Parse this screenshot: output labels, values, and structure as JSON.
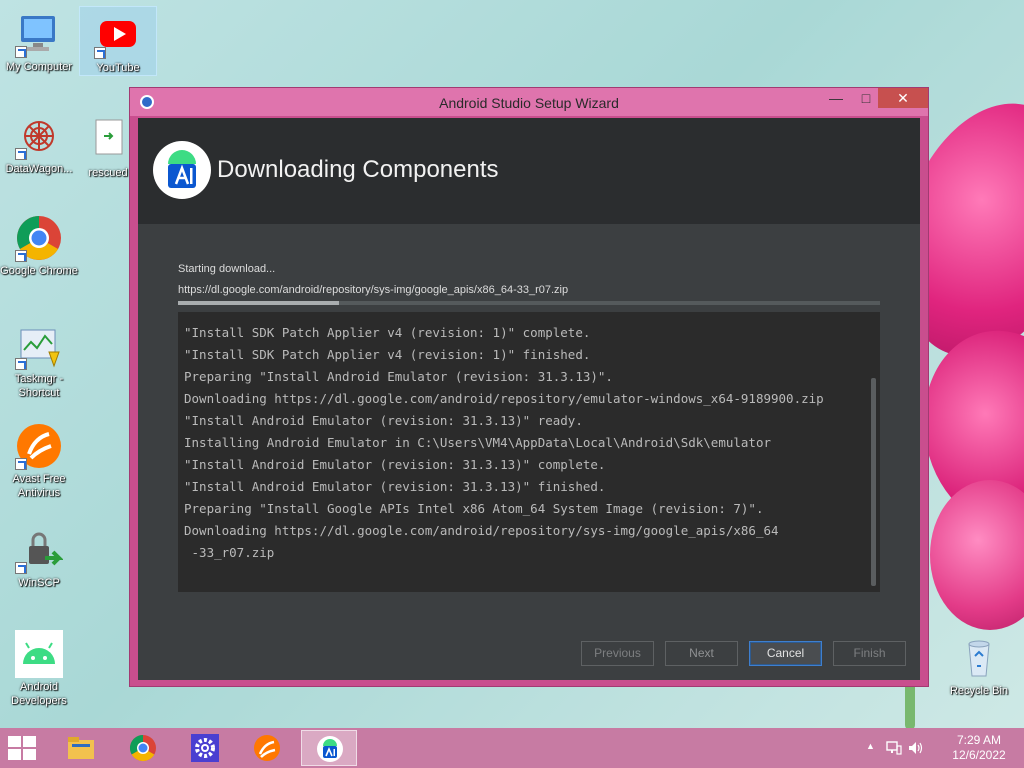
{
  "desktop": {
    "icons": [
      {
        "label": "My Computer",
        "icon": "my-computer-icon"
      },
      {
        "label": "YouTube",
        "icon": "youtube-icon"
      },
      {
        "label": "DataWagon...",
        "icon": "datawagon-icon"
      },
      {
        "label": "rescued",
        "icon": "document-icon"
      },
      {
        "label": "Google Chrome",
        "icon": "chrome-icon"
      },
      {
        "label": "Taskmgr - Shortcut",
        "icon": "taskmgr-icon"
      },
      {
        "label": "Avast Free Antivirus",
        "icon": "avast-icon"
      },
      {
        "label": "WinSCP",
        "icon": "winscp-icon"
      },
      {
        "label": "Android Developers",
        "icon": "android-icon"
      },
      {
        "label": "Recycle Bin",
        "icon": "recycle-bin-icon"
      }
    ]
  },
  "window": {
    "title": "Android Studio Setup Wizard",
    "controls": {
      "minimize": "—",
      "maximize": "□",
      "close": "✕"
    },
    "header": {
      "title": "Downloading Components"
    },
    "status": "Starting download...",
    "url": "https://dl.google.com/android/repository/sys-img/google_apis/x86_64-33_r07.zip",
    "progress": 0.23,
    "log": [
      "\"Install SDK Patch Applier v4 (revision: 1)\" complete.",
      "\"Install SDK Patch Applier v4 (revision: 1)\" finished.",
      "Preparing \"Install Android Emulator (revision: 31.3.13)\".",
      "Downloading https://dl.google.com/android/repository/emulator-windows_x64-9189900.zip",
      "\"Install Android Emulator (revision: 31.3.13)\" ready.",
      "Installing Android Emulator in C:\\Users\\VM4\\AppData\\Local\\Android\\Sdk\\emulator",
      "\"Install Android Emulator (revision: 31.3.13)\" complete.",
      "\"Install Android Emulator (revision: 31.3.13)\" finished.",
      "Preparing \"Install Google APIs Intel x86 Atom_64 System Image (revision: 7)\".",
      "Downloading https://dl.google.com/android/repository/sys-img/google_apis/x86_64",
      " -33_r07.zip"
    ],
    "buttons": {
      "previous": "Previous",
      "next": "Next",
      "cancel": "Cancel",
      "finish": "Finish"
    }
  },
  "taskbar": {
    "items": [
      "file-explorer-icon",
      "chrome-icon",
      "settings-icon",
      "avast-icon",
      "android-studio-icon"
    ],
    "tray": {
      "arrow": "▲",
      "time": "7:29 AM",
      "date": "12/6/2022"
    }
  },
  "colors": {
    "title_bar": "#df74ad",
    "window_border": "#c94e8e",
    "dialog_bg": "#3c3f41",
    "header_bg": "#2b2d2f",
    "log_bg": "#2b2b2b",
    "focus_blue": "#3e7fcf",
    "taskbar": "#c77ba3"
  }
}
